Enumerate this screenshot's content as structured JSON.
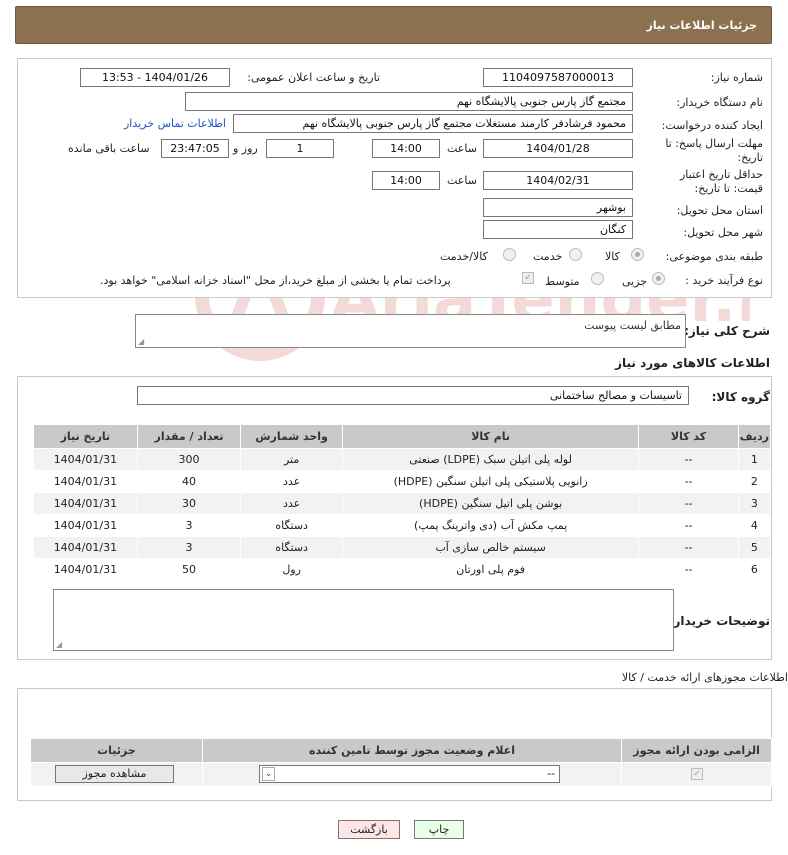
{
  "header": {
    "title": "جزئیات اطلاعات نیاز"
  },
  "form": {
    "need_number_label": "شماره نیاز:",
    "need_number": "1104097587000013",
    "announce_label": "تاریخ و ساعت اعلان عمومی:",
    "announce_value": "1404/01/26 - 13:53",
    "buyer_org_label": "نام دستگاه خریدار:",
    "buyer_org": "مجتمع گاز پارس جنوبی  پالایشگاه نهم",
    "creator_label": "ایجاد کننده درخواست:",
    "creator": "محمود فرشادفر کارمند مستغلات  مجتمع گاز پارس جنوبی  پالایشگاه نهم",
    "contact_link": "اطلاعات تماس خریدار",
    "deadline_label": "مهلت ارسال پاسخ: تا تاریخ:",
    "deadline_date": "1404/01/28",
    "time_label": "ساعت",
    "deadline_time": "14:00",
    "days": "1",
    "days_label": "روز و",
    "remaining_time": "23:47:05",
    "remaining_label": "ساعت باقی مانده",
    "validity_label": "حداقل تاریخ اعتبار قیمت: تا تاریخ:",
    "validity_date": "1404/02/31",
    "validity_time": "14:00",
    "province_label": "استان محل تحویل:",
    "province": "بوشهر",
    "city_label": "شهر محل تحویل:",
    "city": "کنگان",
    "category_label": "طبقه بندی موضوعی:",
    "category_options": [
      "کالا",
      "خدمت",
      "کالا/خدمت"
    ],
    "process_label": "نوع فرآیند خرید :",
    "process_options": [
      "جزیی",
      "متوسط"
    ],
    "payment_note": "پرداخت تمام یا بخشی از مبلغ خرید،از محل \"اسناد خزانه اسلامی\" خواهد بود."
  },
  "description": {
    "label": "شرح کلی نیاز:",
    "value": "مطابق لیست پیوست"
  },
  "goods": {
    "section_title": "اطلاعات کالاهای مورد نیاز",
    "group_label": "گروه کالا:",
    "group_value": "تاسیسات و مصالح ساختمانی",
    "columns": [
      "ردیف",
      "کد کالا",
      "نام کالا",
      "واحد شمارش",
      "تعداد / مقدار",
      "تاریخ نیاز"
    ],
    "rows": [
      [
        "1",
        "--",
        "لوله پلی اتیلن سبک (LDPE) صنعتی",
        "متر",
        "300",
        "1404/01/31"
      ],
      [
        "2",
        "--",
        "زانویی پلاستیکی پلی اتیلن سنگین (HDPE)",
        "عدد",
        "40",
        "1404/01/31"
      ],
      [
        "3",
        "--",
        "بوشن پلی اتیل سنگین (HDPE)",
        "عدد",
        "30",
        "1404/01/31"
      ],
      [
        "4",
        "--",
        "پمپ مکش آب (دی واترینگ پمپ)",
        "دستگاه",
        "3",
        "1404/01/31"
      ],
      [
        "5",
        "--",
        "سیستم خالص سازی آب",
        "دستگاه",
        "3",
        "1404/01/31"
      ],
      [
        "6",
        "--",
        "فوم پلی اورتان",
        "رول",
        "50",
        "1404/01/31"
      ]
    ]
  },
  "buyer_notes": {
    "label": "توضیحات خریدار:"
  },
  "license": {
    "section_title": "اطلاعات مجوزهای ارائه خدمت / کالا",
    "columns": [
      "الزامی بودن ارائه مجوز",
      "اعلام وضعیت مجوز توسط تامین کننده",
      "جزئیات"
    ],
    "select_value": "--",
    "view_button": "مشاهده مجوز"
  },
  "actions": {
    "print": "چاپ",
    "back": "بازگشت"
  },
  "watermark": {
    "text": "AriaTender.net"
  },
  "colors": {
    "header_bg": "#8b7150",
    "link": "#1a55c9",
    "table_header": "#c9c9c9"
  }
}
